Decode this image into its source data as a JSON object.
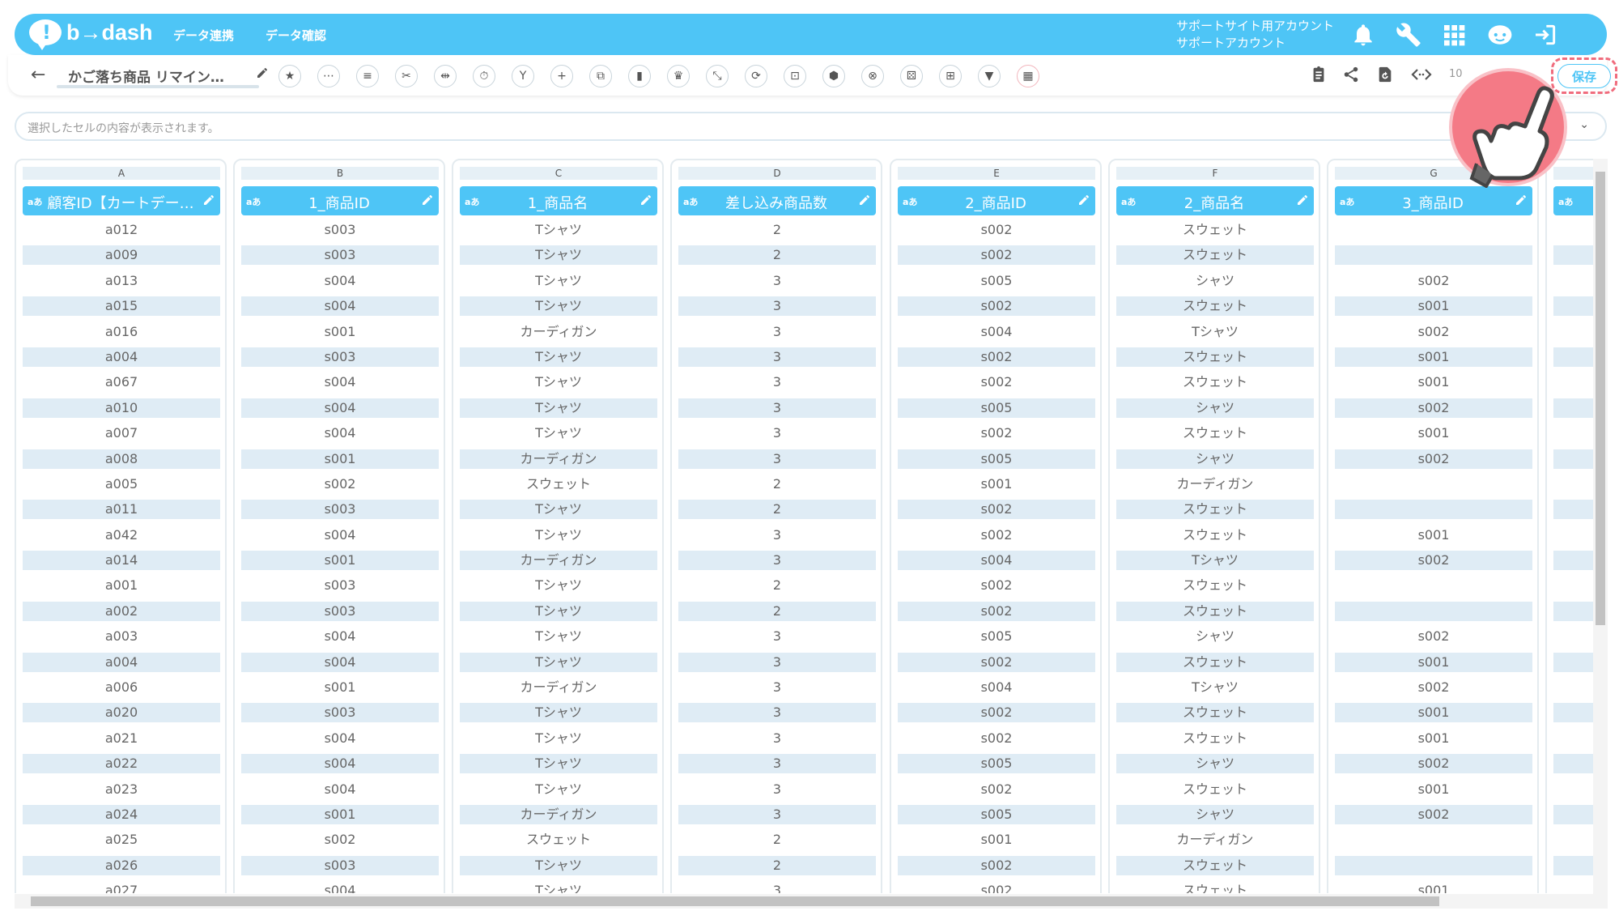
{
  "header": {
    "logo_text": "b→dash",
    "nav": [
      "データ連携",
      "データ確認"
    ],
    "account_line1": "サポートサイト用アカウント",
    "account_line2": "サポートアカウント"
  },
  "toolbar": {
    "title": "かご落ち商品 リマイン…",
    "zoom": "10",
    "save_label": "保存"
  },
  "cellbar": {
    "placeholder": "選択したセルの内容が表示されます。"
  },
  "columns": [
    {
      "letter": "A",
      "type": "aあ",
      "name": "顧客ID【カートデー…",
      "cells": [
        "a012",
        "a009",
        "a013",
        "a015",
        "a016",
        "a004",
        "a067",
        "a010",
        "a007",
        "a008",
        "a005",
        "a011",
        "a042",
        "a014",
        "a001",
        "a002",
        "a003",
        "a004",
        "a006",
        "a020",
        "a021",
        "a022",
        "a023",
        "a024",
        "a025",
        "a026",
        "a027"
      ]
    },
    {
      "letter": "B",
      "type": "aあ",
      "name": "1_商品ID",
      "cells": [
        "s003",
        "s003",
        "s004",
        "s004",
        "s001",
        "s003",
        "s004",
        "s004",
        "s004",
        "s001",
        "s002",
        "s003",
        "s004",
        "s001",
        "s003",
        "s003",
        "s004",
        "s004",
        "s001",
        "s003",
        "s004",
        "s004",
        "s004",
        "s001",
        "s002",
        "s003",
        "s004"
      ]
    },
    {
      "letter": "C",
      "type": "aあ",
      "name": "1_商品名",
      "cells": [
        "Tシャツ",
        "Tシャツ",
        "Tシャツ",
        "Tシャツ",
        "カーディガン",
        "Tシャツ",
        "Tシャツ",
        "Tシャツ",
        "Tシャツ",
        "カーディガン",
        "スウェット",
        "Tシャツ",
        "Tシャツ",
        "カーディガン",
        "Tシャツ",
        "Tシャツ",
        "Tシャツ",
        "Tシャツ",
        "カーディガン",
        "Tシャツ",
        "Tシャツ",
        "Tシャツ",
        "Tシャツ",
        "カーディガン",
        "スウェット",
        "Tシャツ",
        "Tシャツ"
      ]
    },
    {
      "letter": "D",
      "type": "aあ",
      "name": "差し込み商品数",
      "cells": [
        "2",
        "2",
        "3",
        "3",
        "3",
        "3",
        "3",
        "3",
        "3",
        "3",
        "2",
        "2",
        "3",
        "3",
        "2",
        "2",
        "3",
        "3",
        "3",
        "3",
        "3",
        "3",
        "3",
        "3",
        "2",
        "2",
        "3"
      ]
    },
    {
      "letter": "E",
      "type": "aあ",
      "name": "2_商品ID",
      "cells": [
        "s002",
        "s002",
        "s005",
        "s002",
        "s004",
        "s002",
        "s002",
        "s005",
        "s002",
        "s005",
        "s001",
        "s002",
        "s002",
        "s004",
        "s002",
        "s002",
        "s005",
        "s002",
        "s004",
        "s002",
        "s002",
        "s005",
        "s002",
        "s005",
        "s001",
        "s002",
        "s002"
      ]
    },
    {
      "letter": "F",
      "type": "aあ",
      "name": "2_商品名",
      "cells": [
        "スウェット",
        "スウェット",
        "シャツ",
        "スウェット",
        "Tシャツ",
        "スウェット",
        "スウェット",
        "シャツ",
        "スウェット",
        "シャツ",
        "カーディガン",
        "スウェット",
        "スウェット",
        "Tシャツ",
        "スウェット",
        "スウェット",
        "シャツ",
        "スウェット",
        "Tシャツ",
        "スウェット",
        "スウェット",
        "シャツ",
        "スウェット",
        "シャツ",
        "カーディガン",
        "スウェット",
        "スウェット"
      ]
    },
    {
      "letter": "G",
      "type": "aあ",
      "name": "3_商品ID",
      "cells": [
        "",
        "",
        "s002",
        "s001",
        "s002",
        "s001",
        "s001",
        "s002",
        "s001",
        "s002",
        "",
        "",
        "s001",
        "s002",
        "",
        "",
        "s002",
        "s001",
        "s002",
        "s001",
        "s001",
        "s002",
        "s001",
        "s002",
        "",
        "",
        "s001"
      ]
    },
    {
      "letter": "",
      "type": "aあ",
      "name": "",
      "cells": [
        "",
        "",
        "",
        "",
        "",
        "",
        "",
        "",
        "",
        "",
        "",
        "",
        "",
        "",
        "",
        "",
        "",
        "",
        "",
        "",
        "",
        "",
        "",
        "",
        "",
        "",
        ""
      ]
    }
  ]
}
